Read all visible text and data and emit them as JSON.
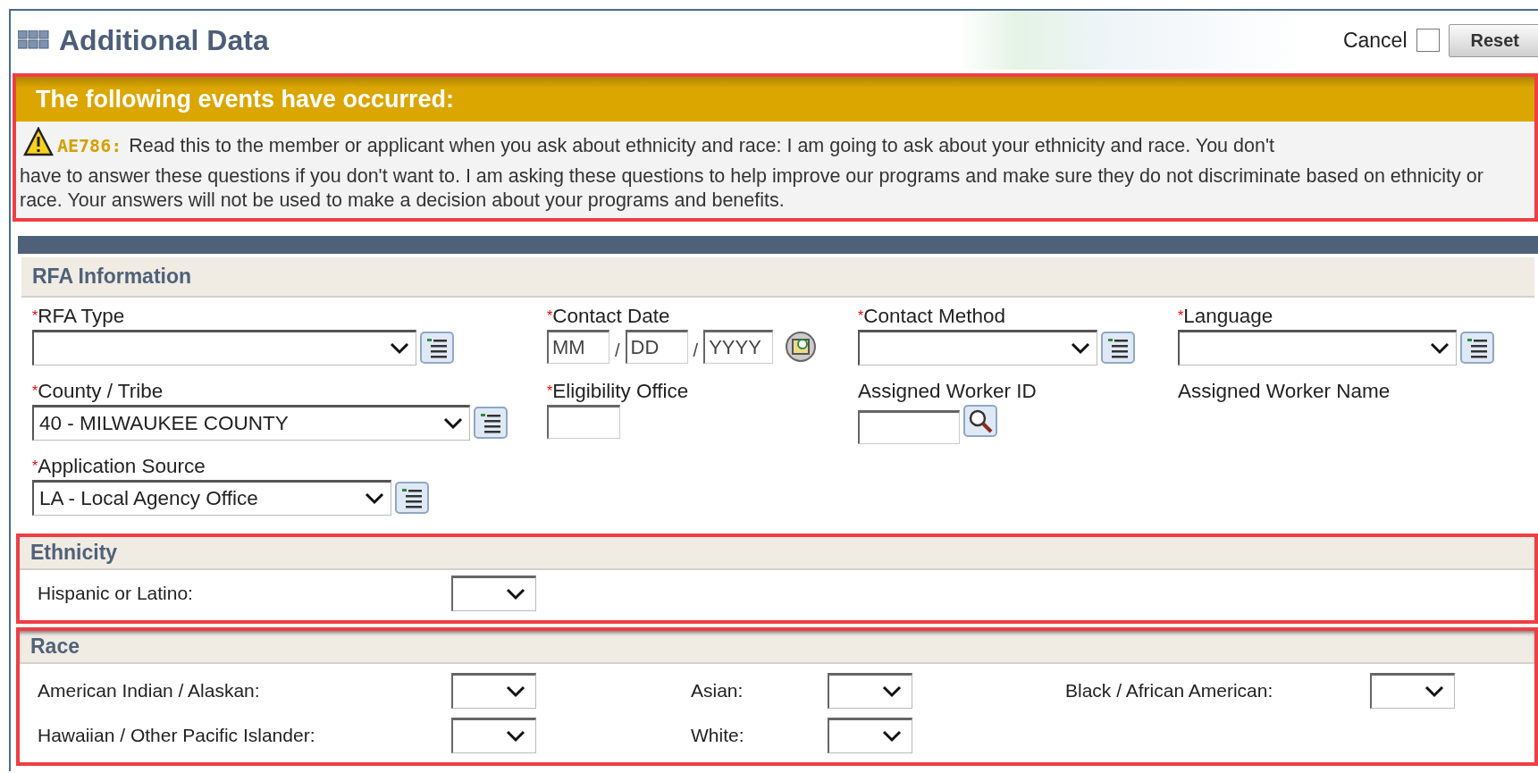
{
  "header": {
    "title": "Additional Data",
    "cancel_label": "Cancel",
    "cancel_checked": false,
    "reset_label": "Reset"
  },
  "alert": {
    "highlighted": true,
    "title": "The following events have occurred:",
    "code": "AE786:",
    "message_first_line": "Read this to the member or applicant when you ask about ethnicity and race: I am going to ask about your ethnicity and race. You don't",
    "message_rest": "have to answer these questions if you don't want to. I am asking these questions to help improve our programs and make sure they do not discriminate based on ethnicity or race. Your answers will not be used to make a decision about your programs and benefits."
  },
  "rfa": {
    "title": "RFA Information",
    "rows": [
      [
        {
          "kind": "select",
          "label": "RFA Type",
          "required_mark": "*"
        },
        {
          "kind": "date",
          "label": "Contact Date",
          "required_mark": "*",
          "placeholders": [
            "MM",
            "DD",
            "YYYY"
          ],
          "separators": [
            "/",
            "/"
          ]
        },
        {
          "kind": "select",
          "label": "Contact Method",
          "required_mark": "*"
        },
        {
          "kind": "select",
          "label": "Language",
          "required_mark": "*"
        }
      ],
      [
        {
          "kind": "select",
          "label": "County / Tribe",
          "required_mark": "*",
          "value": "40 - MILWAUKEE COUNTY"
        },
        {
          "kind": "text",
          "label": "Eligibility Office",
          "required_mark": "*"
        },
        {
          "kind": "search",
          "label": "Assigned Worker ID"
        },
        {
          "kind": "display",
          "label": "Assigned Worker Name"
        }
      ],
      [
        {
          "kind": "select",
          "label": "Application Source",
          "required_mark": "*",
          "value": "LA - Local Agency Office"
        }
      ]
    ]
  },
  "ethnicity": {
    "title": "Ethnicity",
    "highlighted": true,
    "items": [
      {
        "label": "Hispanic or Latino:"
      }
    ]
  },
  "race": {
    "title": "Race",
    "highlighted": true,
    "items": [
      {
        "label": "American Indian / Alaskan:"
      },
      {
        "label": "Asian:"
      },
      {
        "label": "Black / African American:"
      },
      {
        "label": "Hawaiian / Other Pacific Islander:"
      },
      {
        "label": "White:"
      }
    ]
  }
}
